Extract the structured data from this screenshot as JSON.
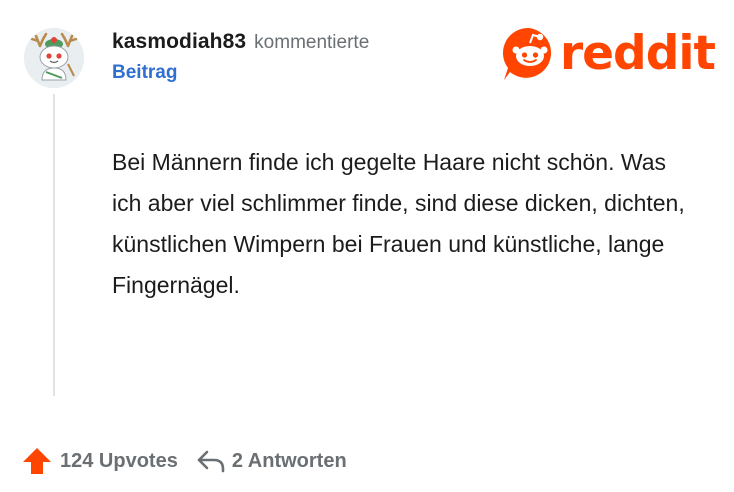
{
  "comment": {
    "username": "kasmodiah83",
    "action": "kommentierte",
    "post_link": "Beitrag",
    "body": "Bei Männern finde ich gegelte Haare nicht schön. Was ich aber viel schlimmer finde, sind diese dicken, dichten, künstlichen Wimpern bei Frauen und künstliche, lange Fingernägel."
  },
  "brand": {
    "name": "reddit",
    "color": "#ff4500"
  },
  "footer": {
    "upvotes_label": "124 Upvotes",
    "replies_label": "2 Antworten"
  },
  "icons": {
    "avatar": "snoo-avatar-antlers",
    "logo": "reddit-snoo-icon",
    "upvote": "upvote-arrow-icon",
    "reply": "reply-arrow-icon"
  },
  "colors": {
    "upvote_arrow": "#ff4500",
    "link": "#2f6fd1",
    "muted": "#6a6f73"
  }
}
